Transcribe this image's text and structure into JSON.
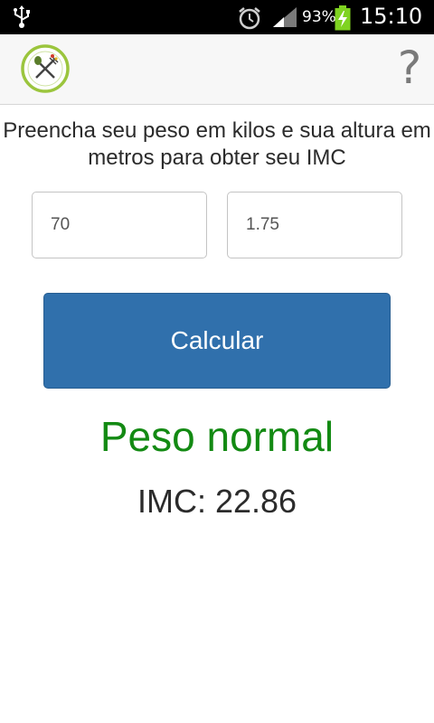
{
  "status_bar": {
    "battery_percent": "93%",
    "time": "15:10",
    "icons": [
      "usb-icon",
      "alarm-icon",
      "signal-icon",
      "battery-charging-icon"
    ]
  },
  "action_bar": {
    "logo_icon": "fork-knife-leaf-logo",
    "help_label": "?"
  },
  "form": {
    "instructions": "Preencha seu peso em kilos e sua altura em metros para obter seu IMC",
    "weight_value": "70",
    "height_value": "1.75",
    "calculate_label": "Calcular"
  },
  "result": {
    "status": "Peso normal",
    "imc_text": "IMC: 22.86",
    "status_color": "#138a13"
  },
  "colors": {
    "button": "#3070ac",
    "status_bar": "#000000"
  }
}
